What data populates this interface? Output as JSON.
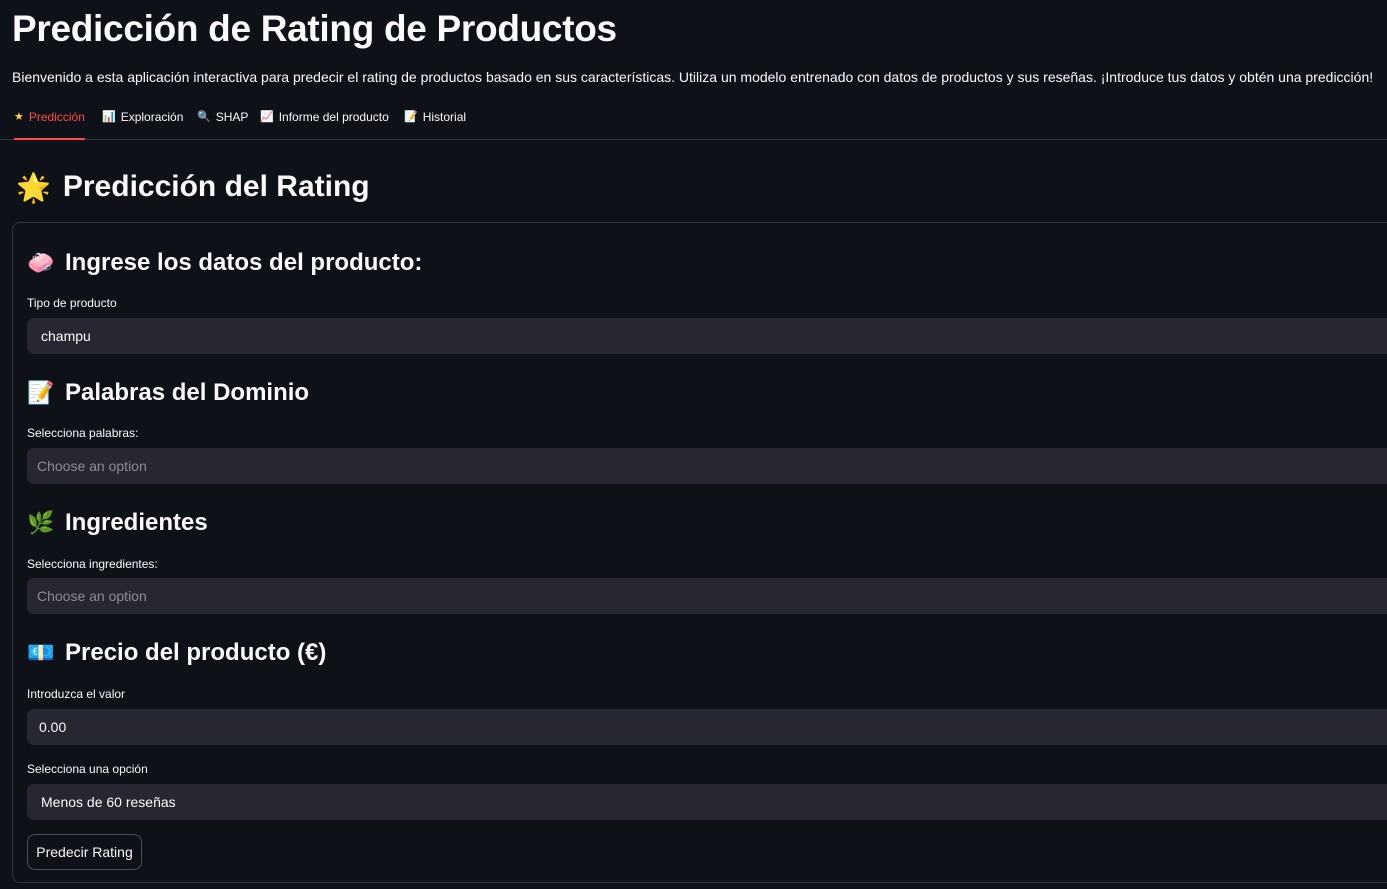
{
  "header": {
    "title": "Predicción de Rating de Productos",
    "intro": "Bienvenido a esta aplicación interactiva para predecir el rating de productos basado en sus características. Utiliza un modelo entrenado con datos de productos y sus reseñas. ¡Introduce tus datos y obtén una predicción!"
  },
  "tabs": [
    {
      "icon": "★",
      "icon_name": "star-icon",
      "label": "Predicción",
      "active": true
    },
    {
      "icon": "📊",
      "icon_name": "bar-chart-icon",
      "label": "Exploración",
      "active": false
    },
    {
      "icon": "🔍",
      "icon_name": "magnifier-icon",
      "label": "SHAP",
      "active": false
    },
    {
      "icon": "📈",
      "icon_name": "line-chart-icon",
      "label": "Informe del producto",
      "active": false
    },
    {
      "icon": "📝",
      "icon_name": "memo-icon",
      "label": "Historial",
      "active": false
    }
  ],
  "main": {
    "section_icon": "🌟",
    "section_title": "Predicción del Rating",
    "form": {
      "product": {
        "icon": "🧼",
        "heading": "Ingrese los datos del producto:",
        "label": "Tipo de producto",
        "value": "champu"
      },
      "words": {
        "icon": "📝",
        "heading": "Palabras del Dominio",
        "label": "Selecciona palabras:",
        "placeholder": "Choose an option"
      },
      "ingredients": {
        "icon": "🌿",
        "heading": "Ingredientes",
        "label": "Selecciona ingredientes:",
        "placeholder": "Choose an option"
      },
      "price": {
        "icon": "💶",
        "heading": "Precio del producto (€)",
        "label": "Introduzca el valor",
        "value": "0.00"
      },
      "reviews": {
        "label": "Selecciona una opción",
        "value": "Menos de 60 reseñas"
      },
      "submit_label": "Predecir Rating"
    }
  },
  "colors": {
    "background": "#0e1117",
    "accent": "#ff4b4b",
    "input_bg": "#262730",
    "border": "#31333f"
  }
}
